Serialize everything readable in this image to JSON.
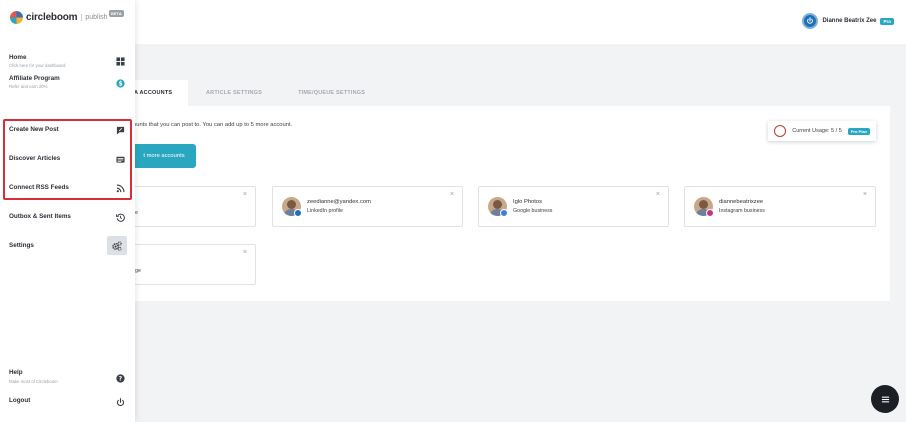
{
  "app": {
    "brand": "circleboom",
    "product": "publish",
    "beta_label": "BETA"
  },
  "user": {
    "name": "Dianne Beatrix Zee",
    "plan_badge": "Pro"
  },
  "sidebar": {
    "items": [
      {
        "label": "Home",
        "sublabel": "Click here for your dashboard",
        "icon": "grid-icon"
      },
      {
        "label": "Affiliate Program",
        "sublabel": "Refer and earn 20%",
        "icon": "dollar-icon"
      },
      {
        "label": "Create New Post",
        "icon": "compose-icon"
      },
      {
        "label": "Discover Articles",
        "icon": "article-icon"
      },
      {
        "label": "Connect RSS Feeds",
        "icon": "rss-icon"
      },
      {
        "label": "Outbox & Sent Items",
        "icon": "history-icon"
      },
      {
        "label": "Settings",
        "icon": "gears-icon"
      },
      {
        "label": "Help",
        "sublabel": "Make most of Circleboom",
        "icon": "question-icon"
      },
      {
        "label": "Logout",
        "icon": "power-icon"
      }
    ]
  },
  "tabs": [
    {
      "label": "A ACCOUNTS",
      "active": true
    },
    {
      "label": "ARTICLE SETTINGS",
      "active": false
    },
    {
      "label": "TIME/QUEUE SETTINGS",
      "active": false
    }
  ],
  "accounts_panel": {
    "info": "ounts that you can post to. You can add up to 5 more account.",
    "connect_button": "t more accounts",
    "usage_label": "Current Usage: 5 / 5",
    "usage_badge": "Pro Plan"
  },
  "accounts": [
    {
      "name": "",
      "type": "e",
      "close": "×"
    },
    {
      "name": "zeedianne@yandex.com",
      "type": "LinkedIn profile",
      "close": "×",
      "network": "linkedin"
    },
    {
      "name": "Iglo Photos",
      "type": "Google business",
      "close": "×",
      "network": "google"
    },
    {
      "name": "diannebeatrixzee",
      "type": "Instagram business",
      "close": "×",
      "network": "instagram"
    },
    {
      "name": "",
      "type": "ge",
      "close": "×"
    }
  ],
  "colors": {
    "accent": "#2aa7c0",
    "highlight": "#d62f3a",
    "linkedin": "#1f6fb8",
    "google": "#3b82d6",
    "instagram": "#c13584"
  }
}
